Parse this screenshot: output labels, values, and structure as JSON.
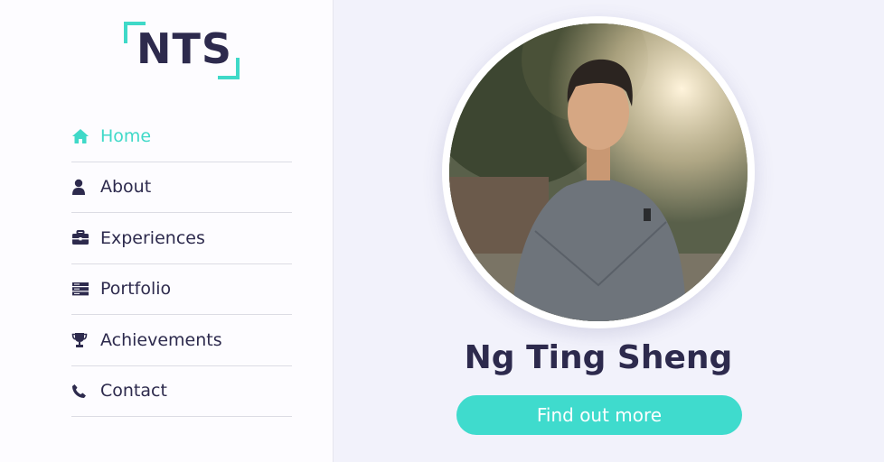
{
  "logo": {
    "text": "NTS",
    "accent_color": "#3fd9c8"
  },
  "nav": {
    "items": [
      {
        "label": "Home",
        "icon": "home-icon",
        "active": true
      },
      {
        "label": "About",
        "icon": "user-icon",
        "active": false
      },
      {
        "label": "Experiences",
        "icon": "briefcase-icon",
        "active": false
      },
      {
        "label": "Portfolio",
        "icon": "server-icon",
        "active": false
      },
      {
        "label": "Achievements",
        "icon": "trophy-icon",
        "active": false
      },
      {
        "label": "Contact",
        "icon": "phone-icon",
        "active": false
      }
    ]
  },
  "hero": {
    "name": "Ng Ting Sheng",
    "cta_label": "Find out more"
  },
  "colors": {
    "accent": "#3fd9c8",
    "text_dark": "#2d2a4d",
    "main_bg": "#f2f2fb",
    "sidebar_bg": "#fdfcff"
  }
}
